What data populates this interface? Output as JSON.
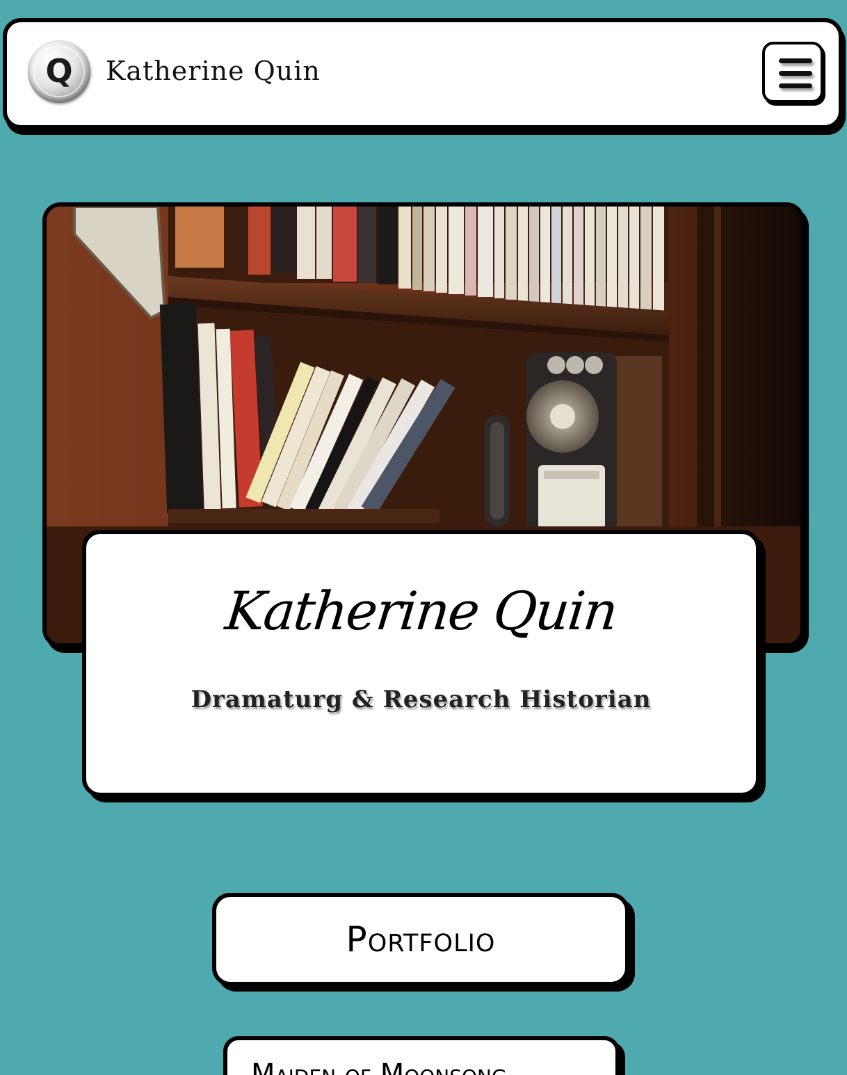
{
  "header": {
    "logo_letter": "Q",
    "site_name": "Katherine Quin"
  },
  "hero": {
    "title": "Katherine Quin",
    "subtitle": "Dramaturg & Research Historian"
  },
  "buttons": {
    "portfolio_label": "Portfolio"
  },
  "projects": {
    "first_title": "Maiden of Moonsong"
  },
  "colors": {
    "background": "#4faab0",
    "card": "#ffffff",
    "border": "#000000"
  },
  "icons": {
    "menu": "hamburger-menu-icon",
    "logo": "q-logo-icon"
  }
}
